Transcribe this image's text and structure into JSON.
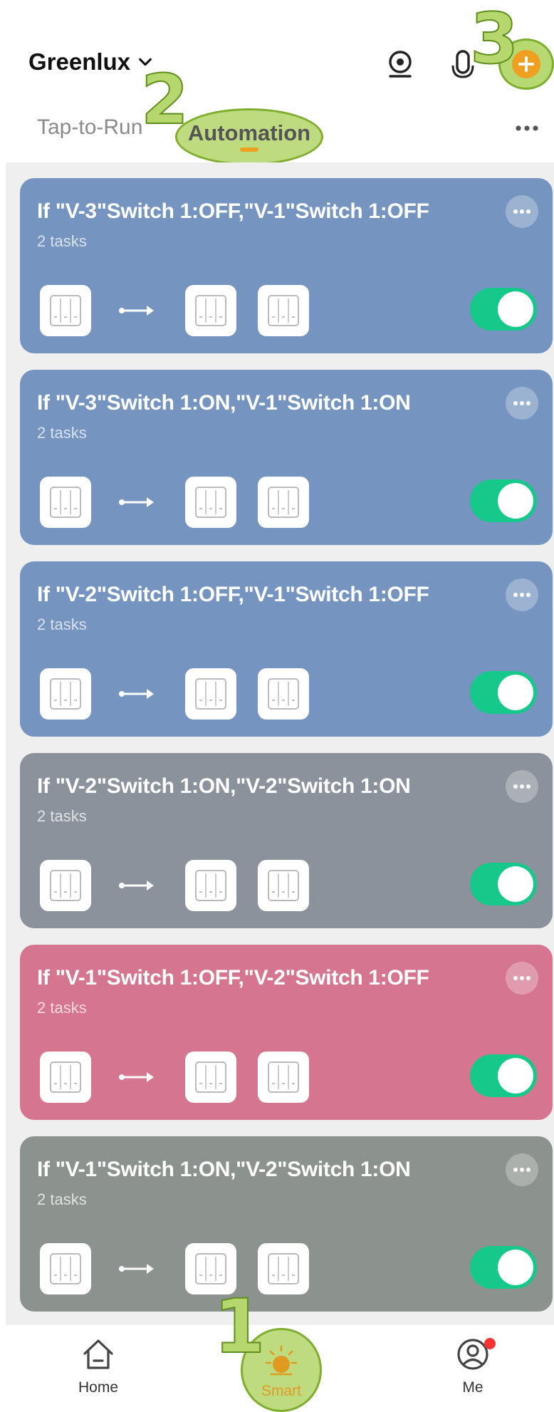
{
  "header": {
    "home_name": "Greenlux",
    "icons": [
      "chevron-down-icon",
      "camera-icon",
      "mic-icon",
      "add-icon"
    ]
  },
  "tabs": [
    {
      "label": "Tap-to-Run",
      "selected": false
    },
    {
      "label": "Automation",
      "selected": true
    }
  ],
  "annotations": {
    "a1": "1",
    "a2": "2",
    "a3": "3"
  },
  "automations": [
    {
      "title": "If \"V-3\"Switch 1:OFF,\"V-1\"Switch 1:OFF",
      "subtitle": "2 tasks",
      "enabled": true,
      "color": "#7595c0"
    },
    {
      "title": "If \"V-3\"Switch 1:ON,\"V-1\"Switch 1:ON",
      "subtitle": "2 tasks",
      "enabled": true,
      "color": "#7595c0"
    },
    {
      "title": "If \"V-2\"Switch 1:OFF,\"V-1\"Switch 1:OFF",
      "subtitle": "2 tasks",
      "enabled": true,
      "color": "#7595c0"
    },
    {
      "title": "If \"V-2\"Switch 1:ON,\"V-2\"Switch 1:ON",
      "subtitle": "2 tasks",
      "enabled": true,
      "color": "#8b929c"
    },
    {
      "title": "If \"V-1\"Switch 1:OFF,\"V-2\"Switch 1:OFF",
      "subtitle": "2 tasks",
      "enabled": true,
      "color": "#d6758f"
    },
    {
      "title": "If \"V-1\"Switch 1:ON,\"V-2\"Switch 1:ON",
      "subtitle": "2 tasks",
      "enabled": true,
      "color": "#8c928e"
    }
  ],
  "bottom_nav": [
    {
      "label": "Home",
      "icon": "home-icon",
      "active": false
    },
    {
      "label": "Smart",
      "icon": "sun-icon",
      "active": true
    },
    {
      "label": "Me",
      "icon": "user-icon",
      "active": false,
      "badge": true
    }
  ],
  "colors": {
    "accent": "#f0a020",
    "toggle_on": "#16c88a",
    "annotation": "#b6d66e",
    "badge": "#ff3333"
  }
}
